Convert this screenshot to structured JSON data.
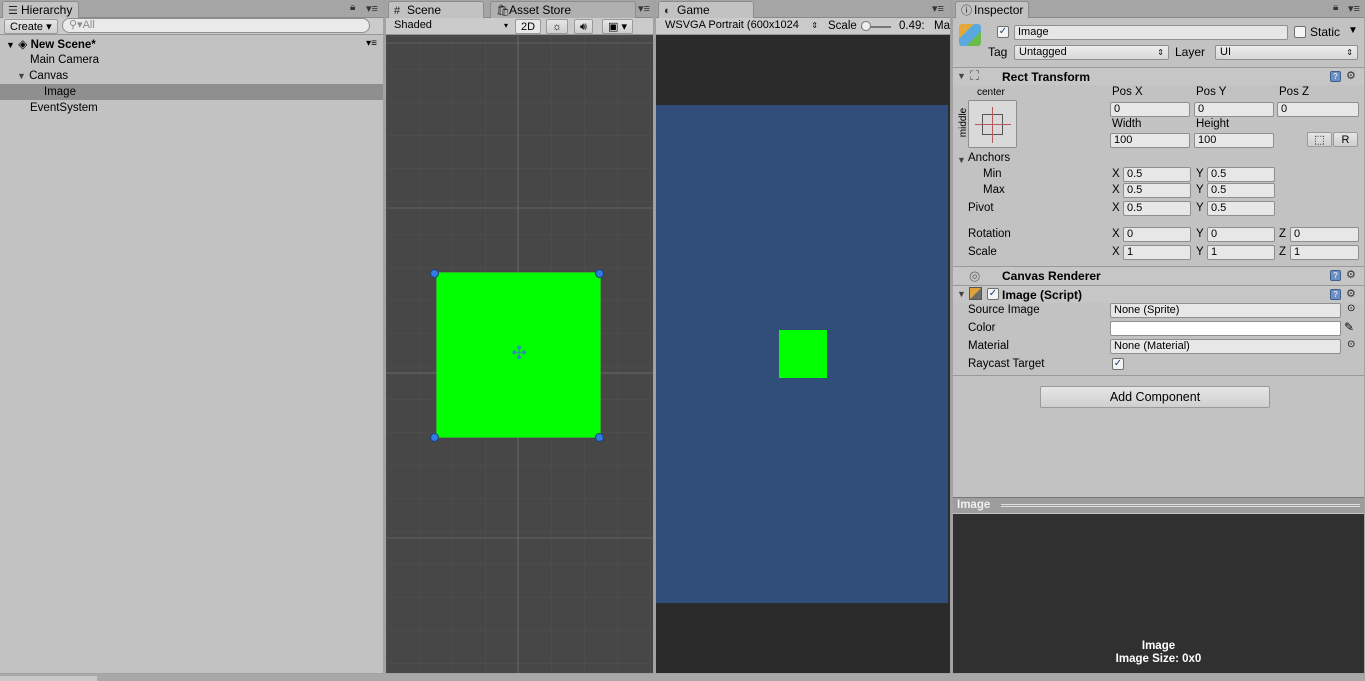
{
  "hierarchy": {
    "tab_label": "Hierarchy",
    "create_label": "Create",
    "search_placeholder": "All",
    "scene_name": "New Scene*",
    "items": [
      "Main Camera",
      "Canvas",
      "Image",
      "EventSystem"
    ]
  },
  "scene": {
    "tab_label": "Scene",
    "asset_store_label": "Asset Store",
    "shading_mode": "Shaded",
    "mode_2d": "2D"
  },
  "game": {
    "tab_label": "Game",
    "resolution": "WSVGA Portrait (600x1024",
    "scale_label": "Scale",
    "scale_value": "0.49:",
    "maximize_label": "Ma"
  },
  "inspector": {
    "tab_label": "Inspector",
    "object_name": "Image",
    "static_label": "Static",
    "tag_label": "Tag",
    "tag_value": "Untagged",
    "layer_label": "Layer",
    "layer_value": "UI",
    "rect_transform": {
      "title": "Rect Transform",
      "anchor_h": "center",
      "anchor_v": "middle",
      "pos_x_label": "Pos X",
      "pos_y_label": "Pos Y",
      "pos_z_label": "Pos Z",
      "pos_x": "0",
      "pos_y": "0",
      "pos_z": "0",
      "width_label": "Width",
      "height_label": "Height",
      "width": "100",
      "height": "100",
      "r_button": "R",
      "anchors_label": "Anchors",
      "min_label": "Min",
      "max_label": "Max",
      "pivot_label": "Pivot",
      "min_x": "0.5",
      "min_y": "0.5",
      "max_x": "0.5",
      "max_y": "0.5",
      "pivot_x": "0.5",
      "pivot_y": "0.5",
      "rotation_label": "Rotation",
      "rot_x": "0",
      "rot_y": "0",
      "rot_z": "0",
      "scale_label": "Scale",
      "scale_x": "1",
      "scale_y": "1",
      "scale_z": "1",
      "x": "X",
      "y": "Y",
      "z": "Z"
    },
    "canvas_renderer": {
      "title": "Canvas Renderer"
    },
    "image_script": {
      "title": "Image (Script)",
      "source_image_label": "Source Image",
      "source_image_value": "None (Sprite)",
      "color_label": "Color",
      "material_label": "Material",
      "material_value": "None (Material)",
      "raycast_label": "Raycast Target"
    },
    "add_component_label": "Add Component",
    "preview": {
      "header": "Image",
      "name": "Image",
      "size": "Image Size: 0x0"
    }
  },
  "colors": {
    "image_green": "#00ff00",
    "game_bg": "#314d79",
    "scene_bg": "#474747"
  }
}
